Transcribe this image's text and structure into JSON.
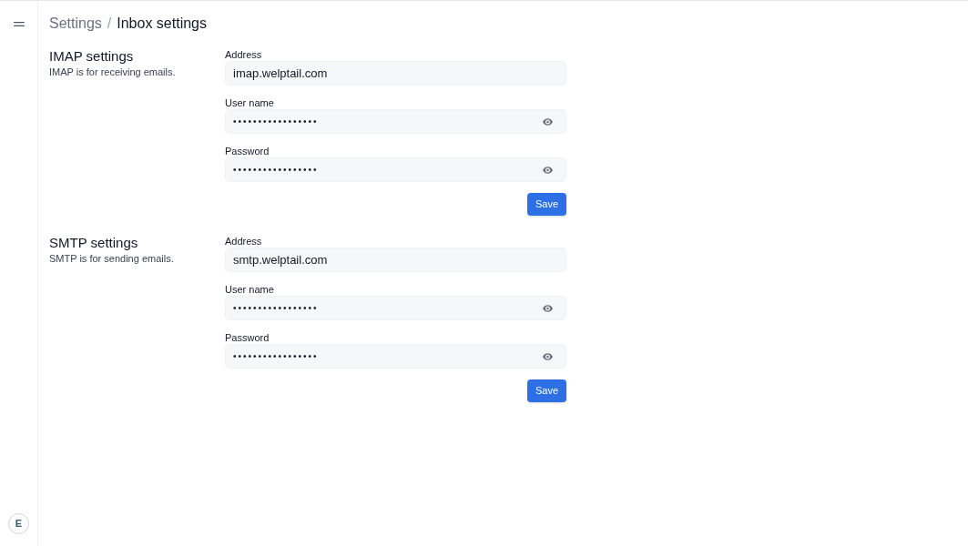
{
  "sidebar": {
    "avatar": {
      "initial": "E"
    }
  },
  "breadcrumb": {
    "separator": "/",
    "items": [
      {
        "label": "Settings",
        "current": false
      },
      {
        "label": "Inbox settings",
        "current": true
      }
    ]
  },
  "sections": [
    {
      "title": "IMAP settings",
      "description": "IMAP is for receiving emails.",
      "fields": [
        {
          "label": "Address",
          "value": "imap.welptail.com",
          "kind": "text"
        },
        {
          "label": "User name",
          "value": "•••••••••••••••••",
          "kind": "secret"
        },
        {
          "label": "Password",
          "value": "•••••••••••••••••",
          "kind": "secret"
        }
      ],
      "button": "Save"
    },
    {
      "title": "SMTP settings",
      "description": "SMTP is for sending emails.",
      "fields": [
        {
          "label": "Address",
          "value": "smtp.welptail.com",
          "kind": "text"
        },
        {
          "label": "User name",
          "value": "•••••••••••••••••",
          "kind": "secret"
        },
        {
          "label": "Password",
          "value": "•••••••••••••••••",
          "kind": "secret"
        }
      ],
      "button": "Save"
    }
  ]
}
